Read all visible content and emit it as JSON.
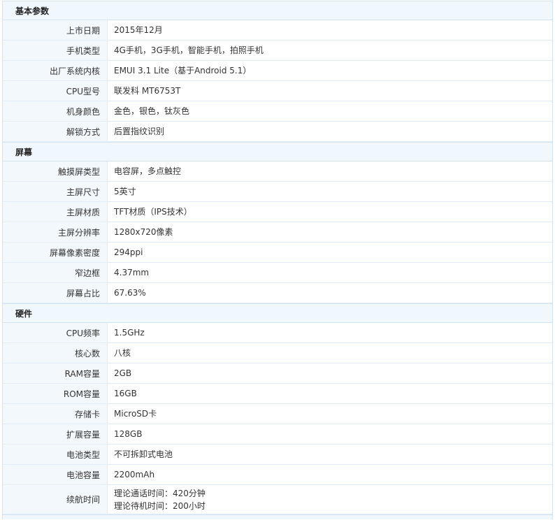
{
  "sections": [
    {
      "title": "基本参数",
      "rows": [
        {
          "label": "上市日期",
          "value": "2015年12月"
        },
        {
          "label": "手机类型",
          "value": "4G手机，3G手机，智能手机，拍照手机"
        },
        {
          "label": "出厂系统内核",
          "value": "EMUI 3.1 Lite（基于Android 5.1）"
        },
        {
          "label": "CPU型号",
          "value": "联发科 MT6753T"
        },
        {
          "label": "机身颜色",
          "value": "金色，银色，钛灰色"
        },
        {
          "label": "解锁方式",
          "value": "后置指纹识别"
        }
      ]
    },
    {
      "title": "屏幕",
      "rows": [
        {
          "label": "触摸屏类型",
          "value": "电容屏，多点触控"
        },
        {
          "label": "主屏尺寸",
          "value": "5英寸"
        },
        {
          "label": "主屏材质",
          "value": "TFT材质（IPS技术）"
        },
        {
          "label": "主屏分辨率",
          "value": "1280x720像素"
        },
        {
          "label": "屏幕像素密度",
          "value": "294ppi"
        },
        {
          "label": "窄边框",
          "value": "4.37mm"
        },
        {
          "label": "屏幕占比",
          "value": "67.63%"
        }
      ]
    },
    {
      "title": "硬件",
      "rows": [
        {
          "label": "CPU频率",
          "value": "1.5GHz"
        },
        {
          "label": "核心数",
          "value": "八核"
        },
        {
          "label": "RAM容量",
          "value": "2GB"
        },
        {
          "label": "ROM容量",
          "value": "16GB"
        },
        {
          "label": "存储卡",
          "value": "MicroSD卡"
        },
        {
          "label": "扩展容量",
          "value": "128GB"
        },
        {
          "label": "电池类型",
          "value": "不可拆卸式电池"
        },
        {
          "label": "电池容量",
          "value": "2200mAh"
        },
        {
          "label": "续航时间",
          "value": "理论通话时间：420分钟",
          "value2": "理论待机时间：200小时"
        }
      ]
    }
  ]
}
